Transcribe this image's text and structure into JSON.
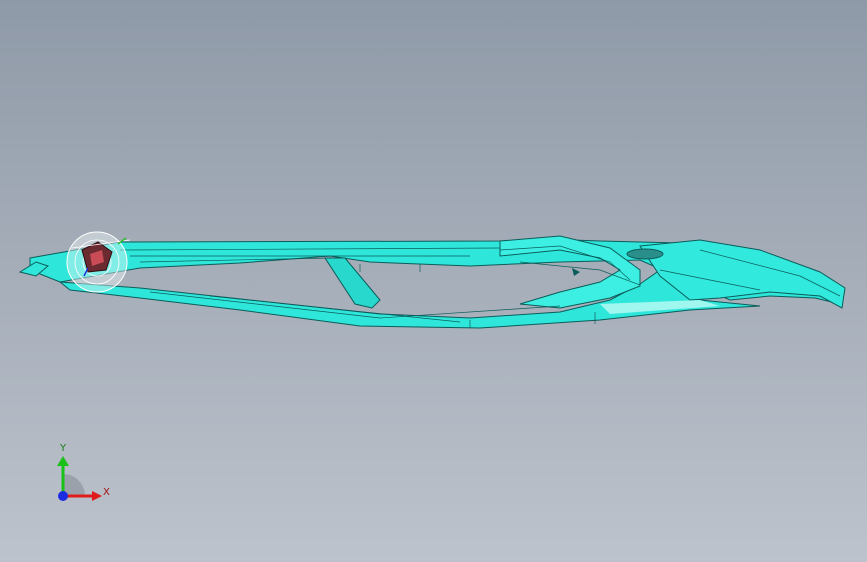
{
  "viewport": {
    "background_top": "#8f9aa8",
    "background_bottom": "#bdc3cc"
  },
  "model": {
    "color_face": "#2ee6da",
    "color_edge": "#0b5d5a",
    "color_highlight": "#9ff7f0"
  },
  "triad": {
    "y_label": "Y",
    "x_label": "X",
    "y_color": "#19c019",
    "x_color": "#e01b1b",
    "z_color": "#1b2de0"
  }
}
